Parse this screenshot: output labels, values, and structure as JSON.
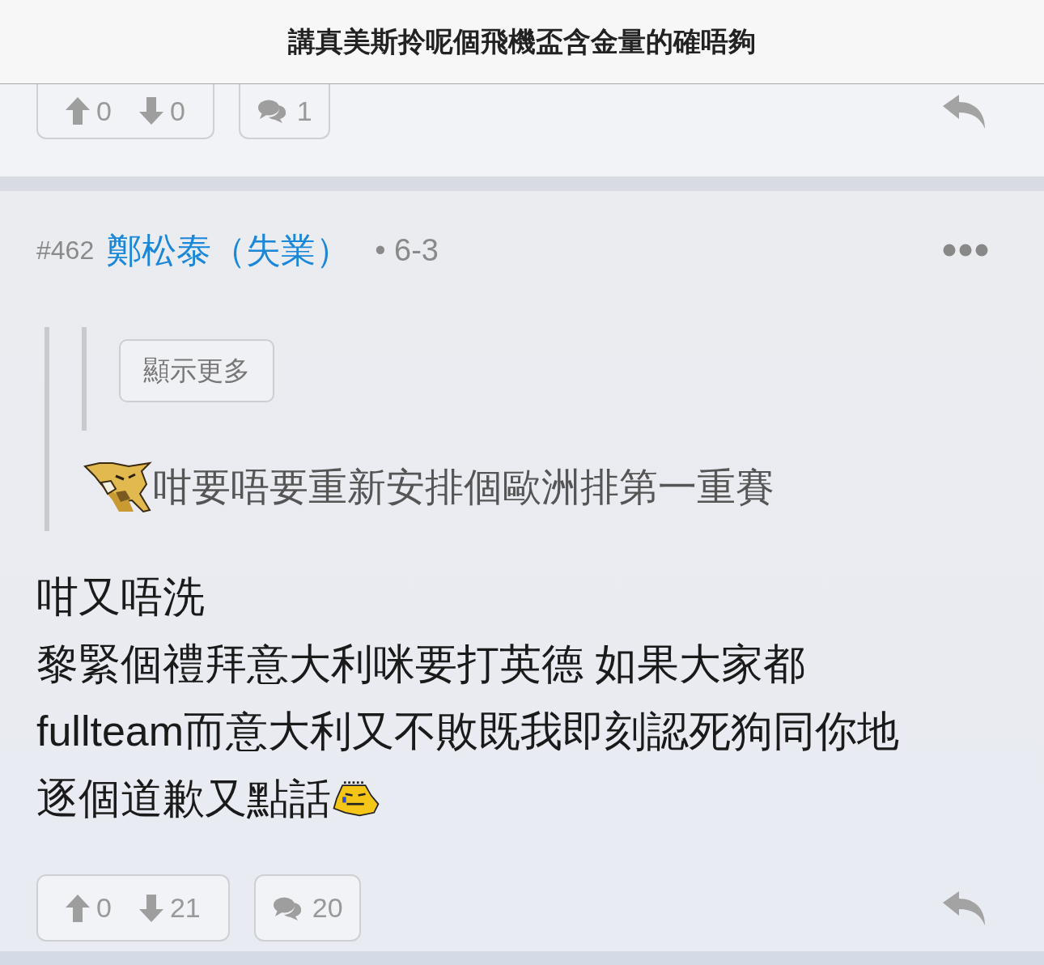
{
  "header": {
    "title": "講真美斯拎呢個飛機盃含金量的確唔夠"
  },
  "posts": [
    {
      "kind": "cut",
      "upvotes": "0",
      "downvotes": "0",
      "replies": "1"
    },
    {
      "kind": "full",
      "number": "#462",
      "author": "鄭松泰（失業）",
      "time": "• 6-3",
      "quote": {
        "show_more": "顯示更多",
        "text": "咁要唔要重新安排個歐洲排第一重賽"
      },
      "body": [
        "咁又唔洗",
        "黎緊個禮拜意大利咪要打英德 如果大家都",
        "fullteam而意大利又不敗既我即刻認死狗同你地",
        "逐個道歉又點話"
      ],
      "upvotes": "0",
      "downvotes": "21",
      "replies": "20"
    }
  ]
}
